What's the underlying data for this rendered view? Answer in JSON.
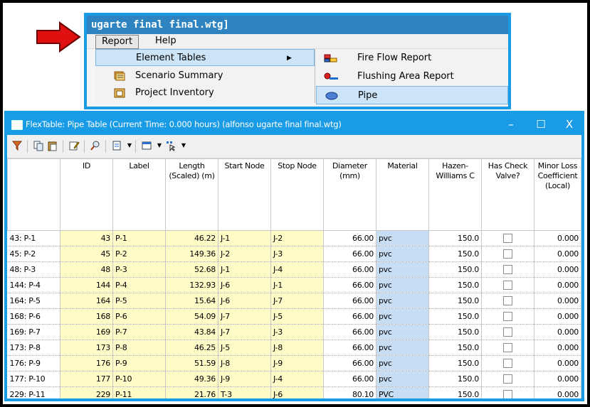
{
  "menu": {
    "window_title": "ugarte final final.wtg]",
    "bar": [
      {
        "label": "Report"
      },
      {
        "label": "Help"
      }
    ],
    "dropdown": [
      {
        "label": "Element Tables",
        "icon": "none"
      },
      {
        "label": "Scenario Summary",
        "icon": "scenario-summary-icon"
      },
      {
        "label": "Project Inventory",
        "icon": "project-inventory-icon"
      }
    ],
    "submenu": [
      {
        "label": "Fire Flow Report",
        "icon": "fire-flow-icon"
      },
      {
        "label": "Flushing Area Report",
        "icon": "flushing-icon"
      },
      {
        "label": "Pipe",
        "icon": "pipe-icon"
      }
    ]
  },
  "window": {
    "title": "FlexTable: Pipe Table (Current Time: 0.000 hours) (alfonso ugarte final final.wtg)",
    "minimize": "–",
    "maximize": "☐",
    "close": "X"
  },
  "table": {
    "columns": [
      "",
      "ID",
      "Label",
      "Length (Scaled) (m)",
      "Start Node",
      "Stop Node",
      "Diameter (mm)",
      "Material",
      "Hazen-Williams C",
      "Has Check Valve?",
      "Minor Loss Coefficient (Local)"
    ],
    "rows": [
      {
        "head": "43: P-1",
        "id": "43",
        "label": "P-1",
        "length": "46.22",
        "start": "J-1",
        "stop": "J-2",
        "diameter": "66.00",
        "material": "pvc",
        "hw": "150.0",
        "check": false,
        "minor": "0.000"
      },
      {
        "head": "45: P-2",
        "id": "45",
        "label": "P-2",
        "length": "149.36",
        "start": "J-2",
        "stop": "J-3",
        "diameter": "66.00",
        "material": "pvc",
        "hw": "150.0",
        "check": false,
        "minor": "0.000"
      },
      {
        "head": "48: P-3",
        "id": "48",
        "label": "P-3",
        "length": "52.68",
        "start": "J-1",
        "stop": "J-4",
        "diameter": "66.00",
        "material": "pvc",
        "hw": "150.0",
        "check": false,
        "minor": "0.000"
      },
      {
        "head": "144: P-4",
        "id": "144",
        "label": "P-4",
        "length": "132.93",
        "start": "J-6",
        "stop": "J-1",
        "diameter": "66.00",
        "material": "pvc",
        "hw": "150.0",
        "check": false,
        "minor": "0.000"
      },
      {
        "head": "164: P-5",
        "id": "164",
        "label": "P-5",
        "length": "15.64",
        "start": "J-6",
        "stop": "J-7",
        "diameter": "66.00",
        "material": "pvc",
        "hw": "150.0",
        "check": false,
        "minor": "0.000"
      },
      {
        "head": "168: P-6",
        "id": "168",
        "label": "P-6",
        "length": "54.09",
        "start": "J-7",
        "stop": "J-5",
        "diameter": "66.00",
        "material": "pvc",
        "hw": "150.0",
        "check": false,
        "minor": "0.000"
      },
      {
        "head": "169: P-7",
        "id": "169",
        "label": "P-7",
        "length": "43.84",
        "start": "J-7",
        "stop": "J-3",
        "diameter": "66.00",
        "material": "pvc",
        "hw": "150.0",
        "check": false,
        "minor": "0.000"
      },
      {
        "head": "173: P-8",
        "id": "173",
        "label": "P-8",
        "length": "46.25",
        "start": "J-5",
        "stop": "J-8",
        "diameter": "66.00",
        "material": "pvc",
        "hw": "150.0",
        "check": false,
        "minor": "0.000"
      },
      {
        "head": "176: P-9",
        "id": "176",
        "label": "P-9",
        "length": "51.59",
        "start": "J-8",
        "stop": "J-9",
        "diameter": "66.00",
        "material": "pvc",
        "hw": "150.0",
        "check": false,
        "minor": "0.000"
      },
      {
        "head": "177: P-10",
        "id": "177",
        "label": "P-10",
        "length": "49.36",
        "start": "J-9",
        "stop": "J-4",
        "diameter": "66.00",
        "material": "pvc",
        "hw": "150.0",
        "check": false,
        "minor": "0.000"
      },
      {
        "head": "229: P-11",
        "id": "229",
        "label": "P-11",
        "length": "21.76",
        "start": "T-3",
        "stop": "J-6",
        "diameter": "80.10",
        "material": "PVC",
        "hw": "150.0",
        "check": false,
        "minor": "0.000"
      }
    ]
  },
  "colors": {
    "accent": "#1a9be6",
    "editable_cell": "#fffcc8",
    "selected_column": "#c7ddf3",
    "arrow": "#e01010"
  }
}
